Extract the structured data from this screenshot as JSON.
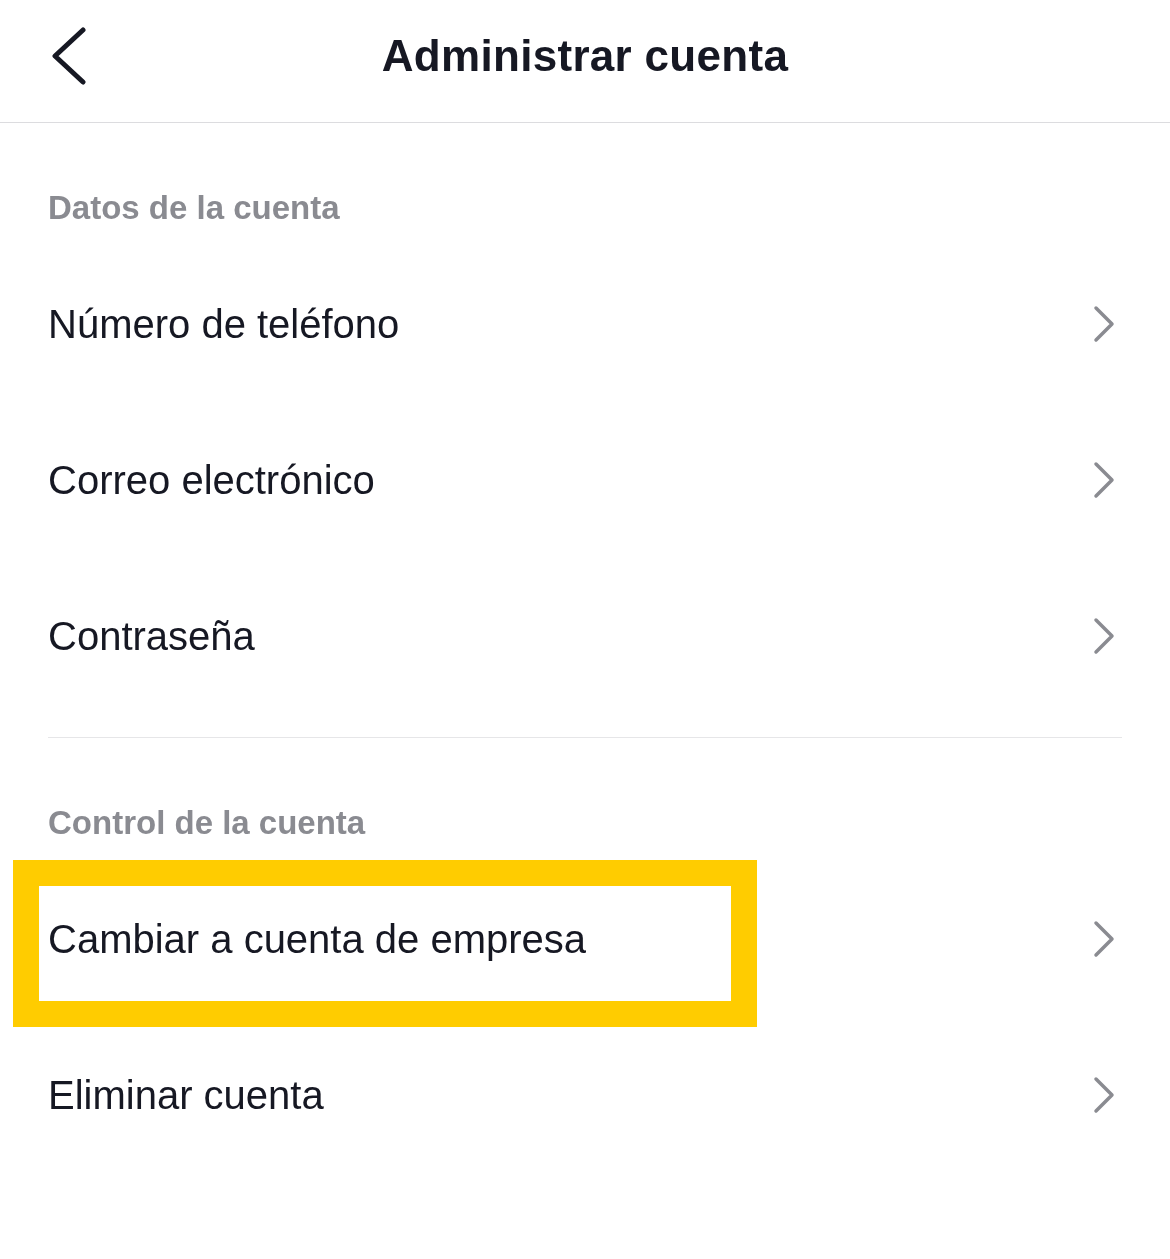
{
  "header": {
    "title": "Administrar cuenta"
  },
  "sections": [
    {
      "heading": "Datos de la cuenta",
      "items": [
        {
          "label": "Número de teléfono",
          "highlighted": false
        },
        {
          "label": "Correo electrónico",
          "highlighted": false
        },
        {
          "label": "Contraseña",
          "highlighted": false
        }
      ]
    },
    {
      "heading": "Control de la cuenta",
      "items": [
        {
          "label": "Cambiar a cuenta de empresa",
          "highlighted": true
        },
        {
          "label": "Eliminar cuenta",
          "highlighted": false
        }
      ]
    }
  ]
}
